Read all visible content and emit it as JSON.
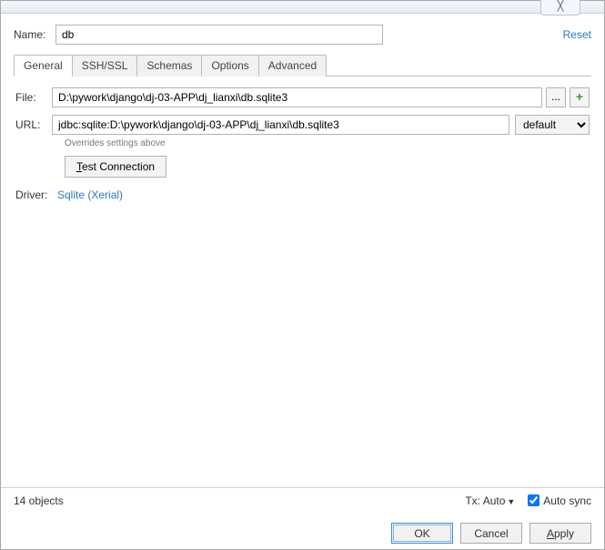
{
  "header": {
    "name_label": "Name:",
    "name_value": "db",
    "reset": "Reset"
  },
  "tabs": {
    "general": "General",
    "ssh": "SSH/SSL",
    "schemas": "Schemas",
    "options": "Options",
    "advanced": "Advanced"
  },
  "form": {
    "file_label": "File:",
    "file_value": "D:\\pywork\\django\\dj-03-APP\\dj_lianxi\\db.sqlite3",
    "url_label": "URL:",
    "url_value": "jdbc:sqlite:D:\\pywork\\django\\dj-03-APP\\dj_lianxi\\db.sqlite3",
    "url_mode": "default",
    "override_hint": "Overrides settings above",
    "test_connection": "est Connection",
    "driver_label": "Driver:",
    "driver_link": "Sqlite (Xerial)",
    "ellipsis": "...",
    "plus": "+"
  },
  "status": {
    "objects": "14 objects",
    "tx_label": "Tx:",
    "tx_value": "Auto",
    "autosync": "Auto sync"
  },
  "buttons": {
    "ok": "OK",
    "cancel": "Cancel",
    "apply": "pply"
  },
  "close_glyph": "┗┓"
}
